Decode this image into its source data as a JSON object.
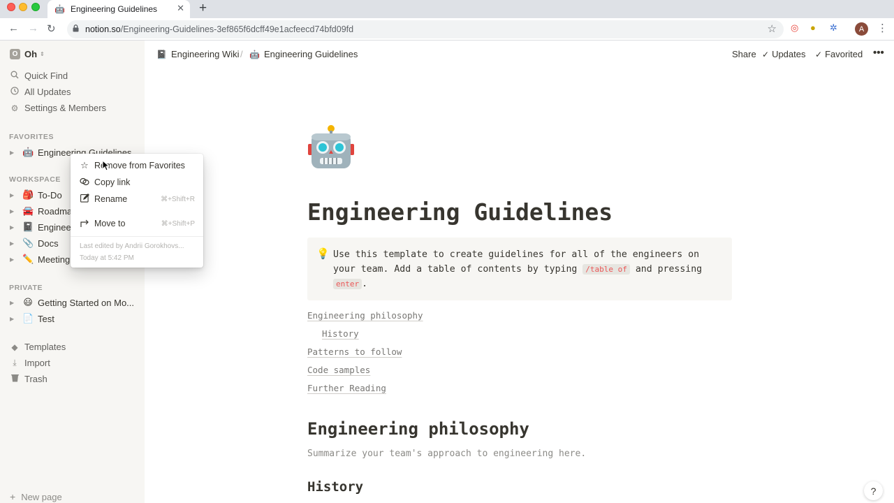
{
  "browser": {
    "tab_title": "Engineering Guidelines",
    "tab_icon": "🤖",
    "url_host": "notion.so",
    "url_path": "/Engineering-Guidelines-3ef865f6dcff49e1acfeecd74bfd09fd",
    "profile_initial": "A"
  },
  "sidebar": {
    "workspace_name": "Oh",
    "workspace_initial": "O",
    "links": [
      {
        "label": "Quick Find",
        "icon": "search-icon"
      },
      {
        "label": "All Updates",
        "icon": "clock-icon"
      },
      {
        "label": "Settings & Members",
        "icon": "gear-icon"
      }
    ],
    "favorites_header": "FAVORITES",
    "favorites": [
      {
        "label": "Engineering Guidelines",
        "emoji": "🤖"
      }
    ],
    "workspace_header": "WORKSPACE",
    "workspace_pages": [
      {
        "label": "To-Do",
        "emoji": "🎒"
      },
      {
        "label": "Roadmap",
        "emoji": "🚘"
      },
      {
        "label": "Engineering Wiki",
        "emoji": "📓"
      },
      {
        "label": "Docs",
        "emoji": "📎"
      },
      {
        "label": "Meeting Notes",
        "emoji": "✏️"
      }
    ],
    "private_header": "PRIVATE",
    "private_pages": [
      {
        "label": "Getting Started on Mo...",
        "emoji": "😃"
      },
      {
        "label": "Test",
        "emoji": "📄"
      }
    ],
    "bottom_links": [
      {
        "label": "Templates",
        "icon": "templates-icon"
      },
      {
        "label": "Import",
        "icon": "import-icon"
      },
      {
        "label": "Trash",
        "icon": "trash-icon"
      }
    ],
    "new_page": "New page"
  },
  "topbar": {
    "breadcrumb_parent": "Engineering Wiki",
    "breadcrumb_parent_emoji": "📓",
    "breadcrumb_separator": "/",
    "breadcrumb_current": "Engineering Guidelines",
    "breadcrumb_current_emoji": "🤖",
    "share": "Share",
    "updates": "Updates",
    "favorited": "Favorited"
  },
  "page": {
    "title": "Engineering Guidelines",
    "callout_emoji": "💡",
    "callout_text_1": "Use this template to create guidelines for all of the engineers on your team. Add a table of contents by typing ",
    "callout_code_1": "/table of",
    "callout_text_2": " and pressing ",
    "callout_code_2": "enter",
    "callout_text_3": ".",
    "toc": [
      "Engineering philosophy",
      "History",
      "Patterns to follow",
      "Code samples",
      "Further Reading"
    ],
    "heading_1": "Engineering philosophy",
    "paragraph_1": "Summarize your team's approach to engineering here.",
    "heading_2": "History",
    "help": "?"
  },
  "context_menu": {
    "items": [
      {
        "label": "Remove from Favorites",
        "icon": "star-icon",
        "shortcut": ""
      },
      {
        "label": "Copy link",
        "icon": "link-icon",
        "shortcut": ""
      },
      {
        "label": "Rename",
        "icon": "edit-icon",
        "shortcut": "⌘+Shift+R"
      },
      {
        "label": "Move to",
        "icon": "move-icon",
        "shortcut": "⌘+Shift+P"
      }
    ],
    "last_edited": "Last edited by Andrii Gorokhovs...",
    "last_edited_time": "Today at 5:42 PM"
  }
}
